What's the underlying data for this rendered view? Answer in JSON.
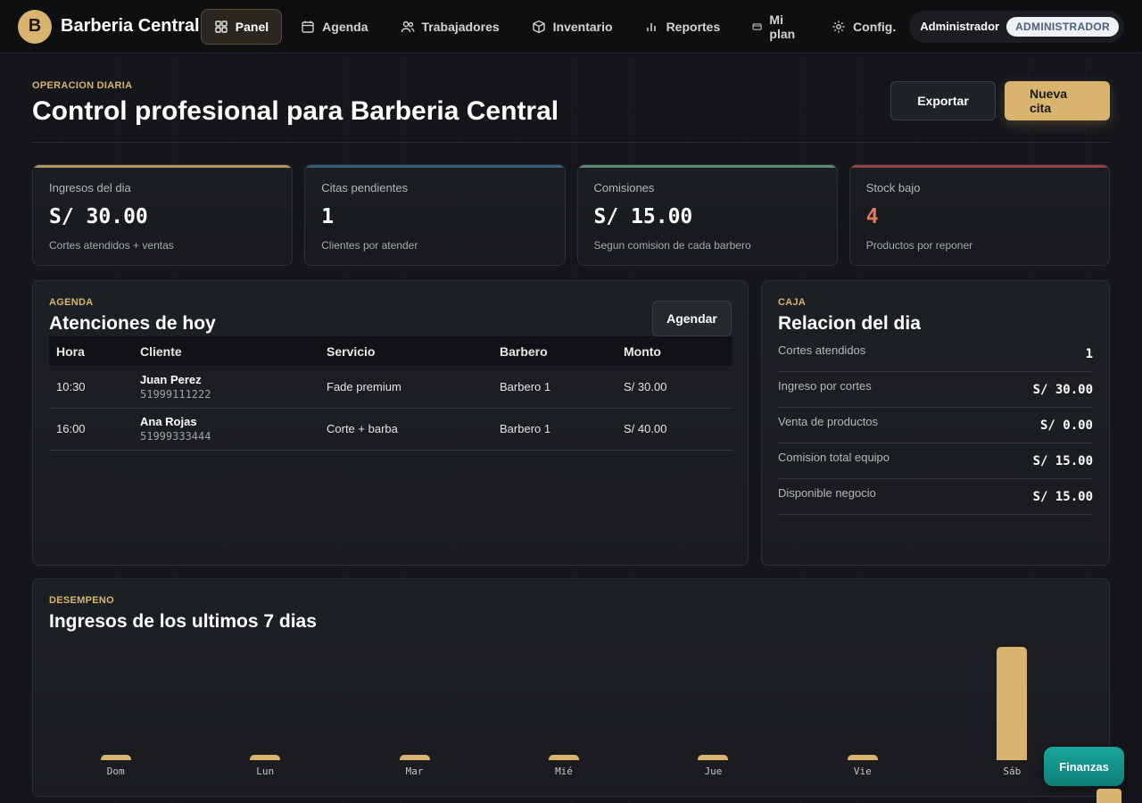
{
  "brand": {
    "logo_letter": "B",
    "name": "Barberia Central"
  },
  "nav": [
    {
      "label": "Panel",
      "icon": "grid-icon",
      "active": true
    },
    {
      "label": "Agenda",
      "icon": "calendar-icon"
    },
    {
      "label": "Trabajadores",
      "icon": "users-icon"
    },
    {
      "label": "Inventario",
      "icon": "box-icon"
    },
    {
      "label": "Reportes",
      "icon": "bar-chart-icon"
    },
    {
      "label": "Mi plan",
      "icon": "card-icon"
    },
    {
      "label": "Config.",
      "icon": "gear-icon"
    }
  ],
  "user": {
    "name": "Administrador",
    "role": "ADMINISTRADOR"
  },
  "header": {
    "eyebrow": "OPERACION DIARIA",
    "title": "Control profesional para Barberia Central",
    "export_label": "Exportar",
    "new_label": "Nueva cita"
  },
  "stats": [
    {
      "label": "Ingresos del dia",
      "value": "S/ 30.00",
      "sub": "Cortes atendidos + ventas",
      "accent": "#d8b46e"
    },
    {
      "label": "Citas pendientes",
      "value": "1",
      "sub": "Clientes por atender",
      "accent": "#3b6f8f"
    },
    {
      "label": "Comisiones",
      "value": "S/ 15.00",
      "sub": "Segun comision de cada barbero",
      "accent": "#6fa48a"
    },
    {
      "label": "Stock bajo",
      "value": "4",
      "sub": "Productos por reponer",
      "accent": "#b54a4a"
    }
  ],
  "agenda": {
    "eyebrow": "AGENDA",
    "title": "Atenciones de hoy",
    "button": "Agendar",
    "columns": [
      "Hora",
      "Cliente",
      "Servicio",
      "Barbero",
      "Monto"
    ],
    "rows": [
      {
        "hora": "10:30",
        "cliente": "Juan Perez",
        "telefono": "51999111222",
        "servicio": "Fade premium",
        "barbero": "Barbero 1",
        "monto": "S/ 30.00"
      },
      {
        "hora": "16:00",
        "cliente": "Ana Rojas",
        "telefono": "51999333444",
        "servicio": "Corte + barba",
        "barbero": "Barbero 1",
        "monto": "S/ 40.00"
      }
    ]
  },
  "caja": {
    "eyebrow": "CAJA",
    "title": "Relacion del dia",
    "rows": [
      {
        "label": "Cortes atendidos",
        "value": "1"
      },
      {
        "label": "Ingreso por cortes",
        "value": "S/ 30.00"
      },
      {
        "label": "Venta de productos",
        "value": "S/ 0.00"
      },
      {
        "label": "Comision total equipo",
        "value": "S/ 15.00"
      },
      {
        "label": "Disponible negocio",
        "value": "S/ 15.00"
      }
    ]
  },
  "performance": {
    "eyebrow": "DESEMPENO",
    "title": "Ingresos de los ultimos 7 dias"
  },
  "chart_data": {
    "type": "bar",
    "categories": [
      "Dom",
      "Lun",
      "Mar",
      "Mié",
      "Jue",
      "Vie",
      "Sáb"
    ],
    "values": [
      0,
      0,
      0,
      0,
      0,
      0,
      30
    ],
    "ylim": [
      0,
      30
    ]
  },
  "fab": {
    "label": "Finanzas"
  },
  "colors": {
    "accent": "#d8b46e",
    "background": "#14161a",
    "fab": "#13938a"
  }
}
